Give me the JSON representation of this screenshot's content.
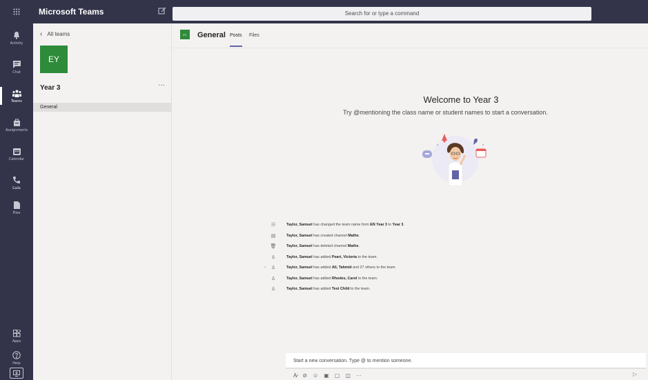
{
  "app": {
    "title": "Microsoft Teams"
  },
  "search": {
    "placeholder": "Search for or type a command"
  },
  "rail": {
    "items": [
      {
        "label": "Activity",
        "icon": "bell-icon"
      },
      {
        "label": "Chat",
        "icon": "chat-icon"
      },
      {
        "label": "Teams",
        "icon": "teams-icon"
      },
      {
        "label": "Assignments",
        "icon": "assignments-icon"
      },
      {
        "label": "Calendar",
        "icon": "calendar-icon"
      },
      {
        "label": "Calls",
        "icon": "phone-icon"
      },
      {
        "label": "Files",
        "icon": "file-icon"
      }
    ],
    "more": "...",
    "bottom": [
      {
        "label": "Apps",
        "icon": "apps-icon"
      },
      {
        "label": "Help",
        "icon": "help-icon"
      }
    ]
  },
  "panel": {
    "back_label": "All teams",
    "team_initials": "EY",
    "team_name": "Year 3",
    "more": "···",
    "channels": [
      "General"
    ]
  },
  "channel": {
    "initials": "EY",
    "title": "General",
    "tabs": [
      "Posts",
      "Files"
    ]
  },
  "welcome": {
    "title": "Welcome to Year 3",
    "subtitle": "Try @mentioning the class name or student names to start a conversation."
  },
  "activity": [
    {
      "icon": "team-rename-icon",
      "actor": "Taylor, Samuel",
      "text1": " has changed the team name from ",
      "bold2": "EN Year 3",
      "text2": " to ",
      "bold3": "Year 3",
      "text3": "."
    },
    {
      "icon": "channel-create-icon",
      "actor": "Taylor, Samuel",
      "text1": " has created channel ",
      "bold2": "Maths",
      "text2": ".",
      "bold3": "",
      "text3": ""
    },
    {
      "icon": "trash-icon",
      "actor": "Taylor, Samuel",
      "text1": " has deleted channel ",
      "bold2": "Maths",
      "text2": ".",
      "bold3": "",
      "text3": ""
    },
    {
      "icon": "add-person-icon",
      "actor": "Taylor, Samuel",
      "text1": " has added ",
      "bold2": "Peart, Victoria",
      "text2": " to the team.",
      "bold3": "",
      "text3": ""
    },
    {
      "icon": "add-person-icon",
      "actor": "Taylor, Samuel",
      "text1": " has added ",
      "bold2": "Ali, Tahmid",
      "text2": " and 27 others to the team.",
      "bold3": "",
      "text3": "",
      "expandable": true
    },
    {
      "icon": "add-person-icon",
      "actor": "Taylor, Samuel",
      "text1": " has added ",
      "bold2": "Rhodes, Carol",
      "text2": " to the team.",
      "bold3": "",
      "text3": ""
    },
    {
      "icon": "add-person-icon",
      "actor": "Taylor, Samuel",
      "text1": " has added ",
      "bold2": "Test Child",
      "text2": " to the team.",
      "bold3": "",
      "text3": ""
    }
  ],
  "compose": {
    "placeholder": "Start a new conversation. Type @ to mention someone.",
    "more": "···"
  },
  "colors": {
    "rail": "#33344a",
    "accent": "#6264a7",
    "team_tile": "#2e8b3a"
  }
}
